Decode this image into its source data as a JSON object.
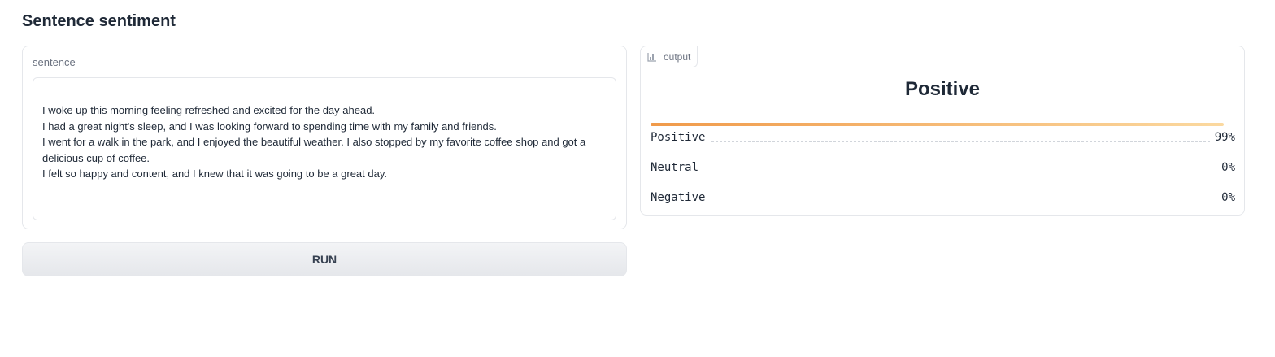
{
  "page": {
    "title": "Sentence sentiment"
  },
  "input": {
    "label": "sentence",
    "lines": [
      "I woke up this morning feeling refreshed and excited for the day ahead.",
      "I had a great night's sleep, and I was looking forward to spending time with my family and friends.",
      "I went for a walk in the park, and I enjoyed the beautiful weather. I also stopped by my favorite coffee shop and got a",
      "delicious cup of coffee.",
      "I felt so happy and content, and I knew that it was going to be a great day."
    ]
  },
  "run_button": {
    "label": "RUN"
  },
  "output": {
    "label": "output",
    "icon": "bar-chart-icon",
    "prediction": "Positive",
    "bar_fraction": 0.99,
    "confidences": [
      {
        "label": "Positive",
        "value": "99%"
      },
      {
        "label": "Neutral",
        "value": "0%"
      },
      {
        "label": "Negative",
        "value": "0%"
      }
    ]
  },
  "colors": {
    "accent_start": "#f09a4a",
    "accent_end": "#fbd9a0",
    "border": "#e5e7eb",
    "muted_text": "#6b7280"
  }
}
